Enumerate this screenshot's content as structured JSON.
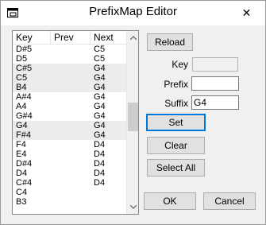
{
  "window": {
    "title": "PrefixMap Editor",
    "close_glyph": "✕"
  },
  "list": {
    "columns": [
      "Key",
      "Prev",
      "Next"
    ],
    "rows": [
      {
        "key": "D#5",
        "prev": "",
        "next": "C5"
      },
      {
        "key": "D5",
        "prev": "",
        "next": "C5"
      },
      {
        "key": "C#5",
        "prev": "",
        "next": "G4"
      },
      {
        "key": "C5",
        "prev": "",
        "next": "G4"
      },
      {
        "key": "B4",
        "prev": "",
        "next": "G4"
      },
      {
        "key": "A#4",
        "prev": "",
        "next": "G4"
      },
      {
        "key": "A4",
        "prev": "",
        "next": "G4"
      },
      {
        "key": "G#4",
        "prev": "",
        "next": "G4"
      },
      {
        "key": "G4",
        "prev": "",
        "next": "G4"
      },
      {
        "key": "F#4",
        "prev": "",
        "next": "G4"
      },
      {
        "key": "F4",
        "prev": "",
        "next": "D4"
      },
      {
        "key": "E4",
        "prev": "",
        "next": "D4"
      },
      {
        "key": "D#4",
        "prev": "",
        "next": "D4"
      },
      {
        "key": "D4",
        "prev": "",
        "next": "D4"
      },
      {
        "key": "C#4",
        "prev": "",
        "next": "D4"
      },
      {
        "key": "C4",
        "prev": "",
        "next": ""
      },
      {
        "key": "B3",
        "prev": "",
        "next": ""
      }
    ]
  },
  "buttons": {
    "reload": "Reload",
    "set": "Set",
    "clear": "Clear",
    "select_all": "Select All",
    "ok": "OK",
    "cancel": "Cancel"
  },
  "fields": {
    "key": {
      "label": "Key",
      "value": ""
    },
    "prefix": {
      "label": "Prefix",
      "value": ""
    },
    "suffix": {
      "label": "Suffix",
      "value": "G4"
    }
  }
}
